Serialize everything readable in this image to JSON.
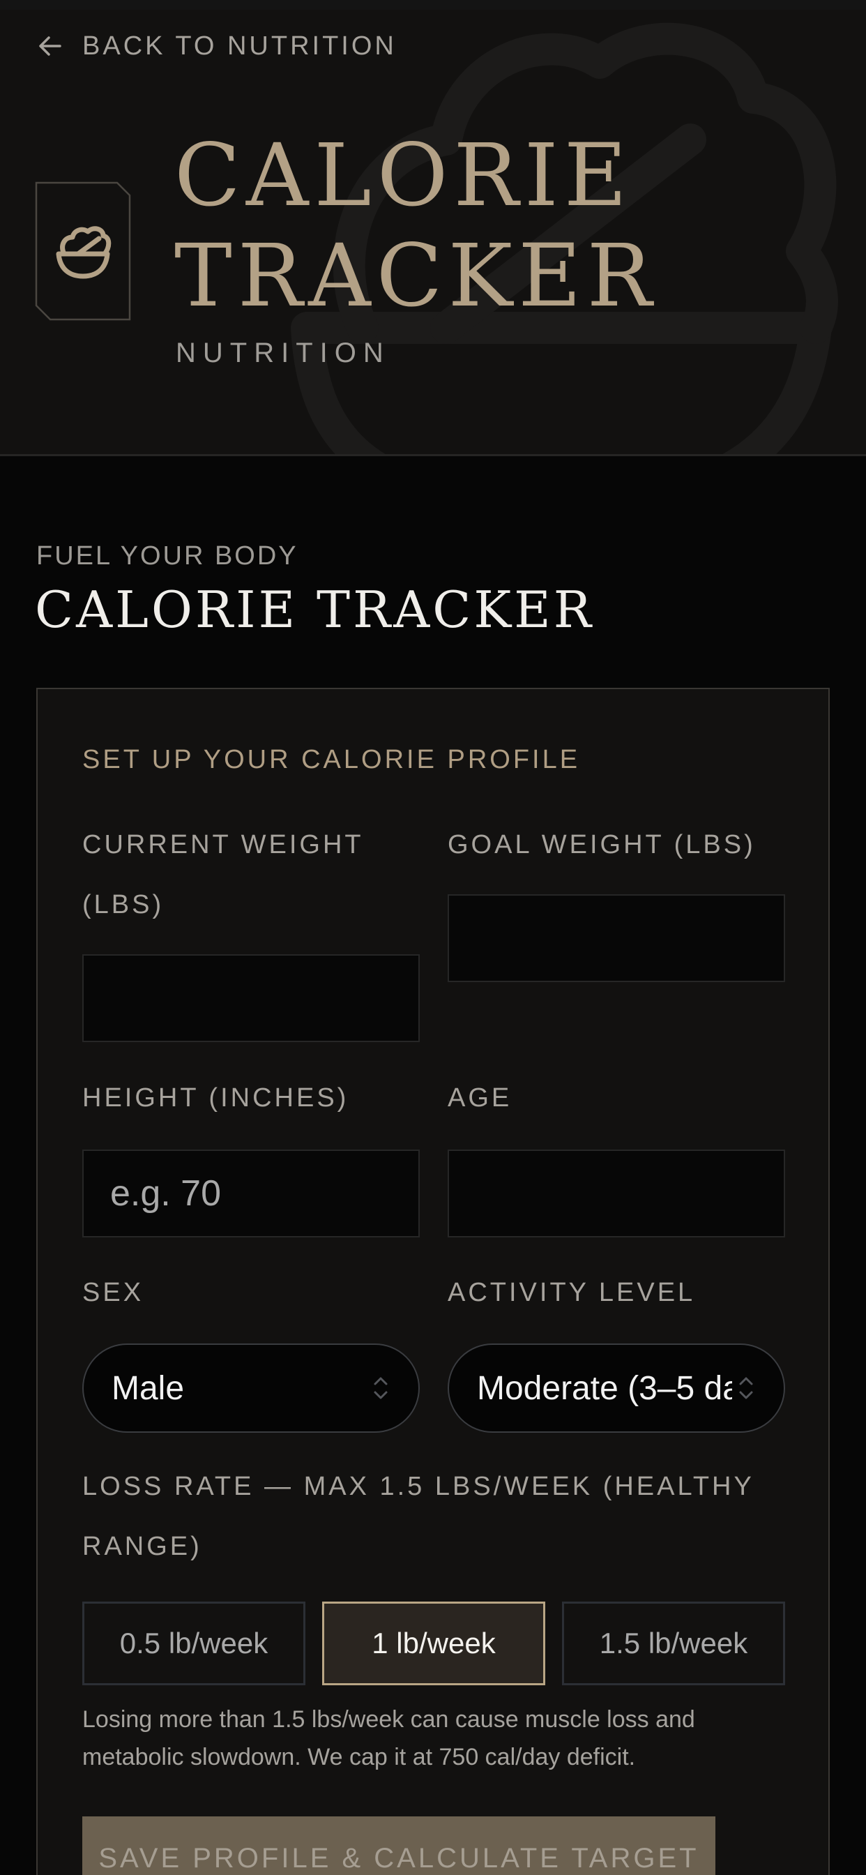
{
  "header": {
    "back_label": "BACK TO NUTRITION",
    "title_line1": "CALORIE",
    "title_line2": "TRACKER",
    "category": "NUTRITION"
  },
  "section": {
    "eyebrow": "FUEL YOUR BODY",
    "title": "CALORIE TRACKER"
  },
  "form": {
    "heading": "SET UP YOUR CALORIE PROFILE",
    "current_weight": {
      "label_line1": "CURRENT WEIGHT",
      "label_line2": "(LBS)",
      "value": "",
      "placeholder": ""
    },
    "goal_weight": {
      "label": "GOAL WEIGHT (LBS)",
      "value": "",
      "placeholder": ""
    },
    "height": {
      "label": "HEIGHT (INCHES)",
      "value": "",
      "placeholder": "e.g. 70"
    },
    "age": {
      "label": "AGE",
      "value": "",
      "placeholder": ""
    },
    "sex": {
      "label": "SEX",
      "selected": "Male"
    },
    "activity": {
      "label": "ACTIVITY LEVEL",
      "selected": "Moderate (3–5 da"
    },
    "loss_rate": {
      "label_line1": "LOSS RATE — MAX 1.5 LBS/WEEK (HEALTHY",
      "label_line2": "RANGE)",
      "options": [
        "0.5 lb/week",
        "1 lb/week",
        "1.5 lb/week"
      ],
      "selected_index": 1
    },
    "note_line1": "Losing more than 1.5 lbs/week can cause muscle loss and",
    "note_line2": "metabolic slowdown. We cap it at 750 cal/day deficit.",
    "save_label": "SAVE PROFILE & CALCULATE TARGET"
  },
  "icons": {
    "back": "arrow-left-icon",
    "badge": "food-bowl-icon",
    "select": "chevron-up-down-icon"
  },
  "colors": {
    "accent": "#b3a186",
    "background": "#060606",
    "card": "#121110",
    "save_button": "#6c6150"
  }
}
